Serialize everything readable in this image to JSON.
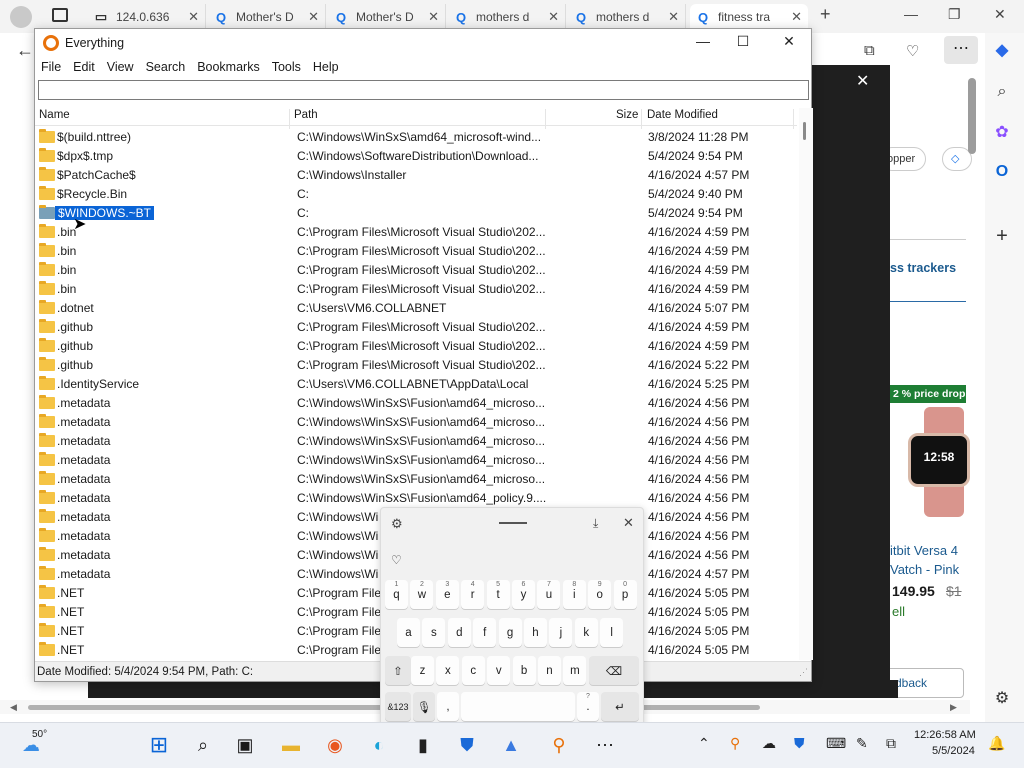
{
  "browser": {
    "tabs": [
      {
        "label": "124.0.636"
      },
      {
        "label": "Mother's D"
      },
      {
        "label": "Mother's D"
      },
      {
        "label": "mothers d"
      },
      {
        "label": "mothers d"
      },
      {
        "label": "fitness tra"
      }
    ],
    "right_content": {
      "shopper_label": "opper",
      "trackers_text": "ss trackers",
      "price_drop": "2 % price drop",
      "watch_time": "12:58",
      "product_line1": "itbit Versa 4",
      "product_line2": "Vatch - Pink",
      "price": "149.95",
      "old_price": "$1",
      "sell": "ell",
      "feedback": "dback"
    }
  },
  "everything": {
    "title": "Everything",
    "menu": [
      "File",
      "Edit",
      "View",
      "Search",
      "Bookmarks",
      "Tools",
      "Help"
    ],
    "search_value": "",
    "columns": {
      "name": "Name",
      "path": "Path",
      "size": "Size",
      "date": "Date Modified"
    },
    "rows": [
      {
        "name": "$(build.nttree)",
        "path": "C:\\Windows\\WinSxS\\amd64_microsoft-wind...",
        "date": "3/8/2024 11:28 PM"
      },
      {
        "name": "$dpx$.tmp",
        "path": "C:\\Windows\\SoftwareDistribution\\Download...",
        "date": "5/4/2024 9:54 PM"
      },
      {
        "name": "$PatchCache$",
        "path": "C:\\Windows\\Installer",
        "date": "4/16/2024 4:57 PM"
      },
      {
        "name": "$Recycle.Bin",
        "path": "C:",
        "date": "5/4/2024 9:40 PM"
      },
      {
        "name": "$WINDOWS.~BT",
        "path": "C:",
        "date": "5/4/2024 9:54 PM",
        "selected": true
      },
      {
        "name": ".bin",
        "path": "C:\\Program Files\\Microsoft Visual Studio\\202...",
        "date": "4/16/2024 4:59 PM"
      },
      {
        "name": ".bin",
        "path": "C:\\Program Files\\Microsoft Visual Studio\\202...",
        "date": "4/16/2024 4:59 PM"
      },
      {
        "name": ".bin",
        "path": "C:\\Program Files\\Microsoft Visual Studio\\202...",
        "date": "4/16/2024 4:59 PM"
      },
      {
        "name": ".bin",
        "path": "C:\\Program Files\\Microsoft Visual Studio\\202...",
        "date": "4/16/2024 4:59 PM"
      },
      {
        "name": ".dotnet",
        "path": "C:\\Users\\VM6.COLLABNET",
        "date": "4/16/2024 5:07 PM"
      },
      {
        "name": ".github",
        "path": "C:\\Program Files\\Microsoft Visual Studio\\202...",
        "date": "4/16/2024 4:59 PM"
      },
      {
        "name": ".github",
        "path": "C:\\Program Files\\Microsoft Visual Studio\\202...",
        "date": "4/16/2024 4:59 PM"
      },
      {
        "name": ".github",
        "path": "C:\\Program Files\\Microsoft Visual Studio\\202...",
        "date": "4/16/2024 5:22 PM"
      },
      {
        "name": ".IdentityService",
        "path": "C:\\Users\\VM6.COLLABNET\\AppData\\Local",
        "date": "4/16/2024 5:25 PM"
      },
      {
        "name": ".metadata",
        "path": "C:\\Windows\\WinSxS\\Fusion\\amd64_microso...",
        "date": "4/16/2024 4:56 PM"
      },
      {
        "name": ".metadata",
        "path": "C:\\Windows\\WinSxS\\Fusion\\amd64_microso...",
        "date": "4/16/2024 4:56 PM"
      },
      {
        "name": ".metadata",
        "path": "C:\\Windows\\WinSxS\\Fusion\\amd64_microso...",
        "date": "4/16/2024 4:56 PM"
      },
      {
        "name": ".metadata",
        "path": "C:\\Windows\\WinSxS\\Fusion\\amd64_microso...",
        "date": "4/16/2024 4:56 PM"
      },
      {
        "name": ".metadata",
        "path": "C:\\Windows\\WinSxS\\Fusion\\amd64_microso...",
        "date": "4/16/2024 4:56 PM"
      },
      {
        "name": ".metadata",
        "path": "C:\\Windows\\WinSxS\\Fusion\\amd64_policy.9....",
        "date": "4/16/2024 4:56 PM"
      },
      {
        "name": ".metadata",
        "path": "C:\\Windows\\Wi",
        "date": "4/16/2024 4:56 PM"
      },
      {
        "name": ".metadata",
        "path": "C:\\Windows\\Wi",
        "date": "4/16/2024 4:56 PM"
      },
      {
        "name": ".metadata",
        "path": "C:\\Windows\\Wi",
        "date": "4/16/2024 4:56 PM"
      },
      {
        "name": ".metadata",
        "path": "C:\\Windows\\Wi",
        "date": "4/16/2024 4:57 PM"
      },
      {
        "name": ".NET",
        "path": "C:\\Program File",
        "date": "4/16/2024 5:05 PM"
      },
      {
        "name": ".NET",
        "path": "C:\\Program File",
        "date": "4/16/2024 5:05 PM"
      },
      {
        "name": ".NET",
        "path": "C:\\Program File",
        "date": "4/16/2024 5:05 PM"
      },
      {
        "name": ".NET",
        "path": "C:\\Program File",
        "date": "4/16/2024 5:05 PM"
      }
    ],
    "status": "Date Modified: 5/4/2024 9:54 PM, Path: C:"
  },
  "keyboard": {
    "row1": [
      {
        "k": "q",
        "n": "1"
      },
      {
        "k": "w",
        "n": "2"
      },
      {
        "k": "e",
        "n": "3"
      },
      {
        "k": "r",
        "n": "4"
      },
      {
        "k": "t",
        "n": "5"
      },
      {
        "k": "y",
        "n": "6"
      },
      {
        "k": "u",
        "n": "7"
      },
      {
        "k": "i",
        "n": "8"
      },
      {
        "k": "o",
        "n": "9"
      },
      {
        "k": "p",
        "n": "0"
      }
    ],
    "row2": [
      "a",
      "s",
      "d",
      "f",
      "g",
      "h",
      "j",
      "k",
      "l"
    ],
    "row3": [
      "z",
      "x",
      "c",
      "v",
      "b",
      "n",
      "m"
    ],
    "symbols_label": "&123",
    "comma": ",",
    "period": ".",
    "period_alt": "?"
  },
  "taskbar": {
    "weather_temp": "50°",
    "clock_time": "12:26:58 AM",
    "clock_date": "5/5/2024"
  }
}
